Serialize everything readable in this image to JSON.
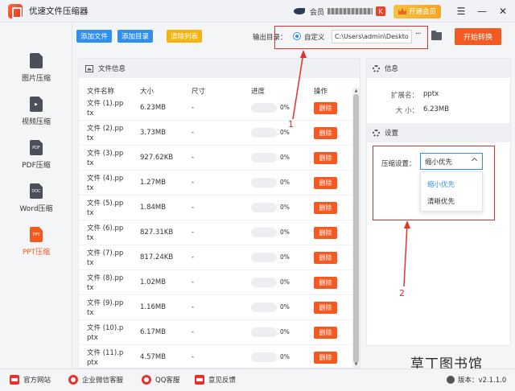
{
  "app": {
    "title": "优速文件压缩器",
    "member_text": "会员"
  },
  "window": {
    "vip_label": "开通会员"
  },
  "sidebar": {
    "items": [
      {
        "label": "图片压缩",
        "glyph": ""
      },
      {
        "label": "视频压缩",
        "glyph": "▶"
      },
      {
        "label": "PDF压缩",
        "glyph": "PDF"
      },
      {
        "label": "Word压缩",
        "glyph": "DOC"
      },
      {
        "label": "PPT压缩",
        "glyph": "PPT"
      }
    ],
    "active_index": 4
  },
  "toolbar": {
    "add_file": "添加文件",
    "add_dir": "添加目录",
    "clear_list": "清除列表",
    "output_label": "输出目录：",
    "custom_label": "自定义",
    "path_value": "C:\\Users\\admin\\Deskto",
    "more_label": "···",
    "start_label": "开始转换"
  },
  "file_panel": {
    "title": "文件信息",
    "columns": {
      "name": "文件名称",
      "size": "大小",
      "dim": "尺寸",
      "progress": "进度",
      "action": "操作"
    },
    "rows": [
      {
        "name": "文件 (1).pptx",
        "size": "6.23MB",
        "dim": "-",
        "progress": 0,
        "pct": "0%"
      },
      {
        "name": "文件 (2).pptx",
        "size": "3.73MB",
        "dim": "-",
        "progress": 0,
        "pct": "0%"
      },
      {
        "name": "文件 (3).pptx",
        "size": "927.62KB",
        "dim": "-",
        "progress": 0,
        "pct": "0%"
      },
      {
        "name": "文件 (4).pptx",
        "size": "1.27MB",
        "dim": "-",
        "progress": 0,
        "pct": "0%"
      },
      {
        "name": "文件 (5).pptx",
        "size": "1.84MB",
        "dim": "-",
        "progress": 0,
        "pct": "0%"
      },
      {
        "name": "文件 (6).pptx",
        "size": "827.31KB",
        "dim": "-",
        "progress": 0,
        "pct": "0%"
      },
      {
        "name": "文件 (7).pptx",
        "size": "817.24KB",
        "dim": "-",
        "progress": 0,
        "pct": "0%"
      },
      {
        "name": "文件 (8).pptx",
        "size": "1.02MB",
        "dim": "-",
        "progress": 0,
        "pct": "0%"
      },
      {
        "name": "文件 (9).pptx",
        "size": "1.16MB",
        "dim": "-",
        "progress": 0,
        "pct": "0%"
      },
      {
        "name": "文件 (10).pptx",
        "size": "6.17MB",
        "dim": "-",
        "progress": 0,
        "pct": "0%"
      },
      {
        "name": "文件 (11).pptx",
        "size": "4.57MB",
        "dim": "-",
        "progress": 0,
        "pct": "0%"
      }
    ],
    "delete_label": "删除"
  },
  "info_panel": {
    "title": "信息",
    "ext_key": "扩展名：",
    "ext_val": "pptx",
    "size_key": "大 小：",
    "size_val": "6.23MB"
  },
  "settings": {
    "title": "设置",
    "compress_label": "压缩设置：",
    "selected": "缩小优先",
    "options": [
      "缩小优先",
      "清晰优先"
    ]
  },
  "annotations": {
    "num1": "1",
    "num2": "2"
  },
  "footer": {
    "website": "官方网站",
    "wechat": "企业微信客服",
    "qq": "QQ客服",
    "feedback": "意见反馈",
    "version": "版本：v2.1.1.0",
    "watermark": "草丁图书馆"
  },
  "colors": {
    "accent": "#2f8ff0",
    "brand": "#f25a22",
    "annotation": "#e8302a"
  }
}
